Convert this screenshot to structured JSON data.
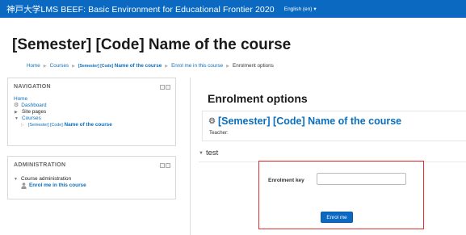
{
  "navbar": {
    "site_title": "神戸大学LMS BEEF: Basic Environment for Educational Frontier 2020",
    "language": "English (en)",
    "language_caret": "▾"
  },
  "page": {
    "title": "[Semester] [Code] Name of the course"
  },
  "breadcrumb": [
    {
      "label": "Home"
    },
    {
      "label": "Courses"
    },
    {
      "label_a": "[Semester] [Code]",
      "label_b": "Name of the course"
    },
    {
      "label": "Enrol me in this course"
    },
    {
      "label": "Enrolment options"
    }
  ],
  "breadcrumb_separator": "▶",
  "navigation_block": {
    "title": "NAVIGATION",
    "home": "Home",
    "dashboard": "Dashboard",
    "site_pages": "Site pages",
    "courses": "Courses",
    "course_a": "[Semester] [Code]",
    "course_b": "Name of the course"
  },
  "admin_block": {
    "title": "ADMINISTRATION",
    "course_administration": "Course administration",
    "enrol_me": "Enrol me in this course"
  },
  "main": {
    "heading": "Enrolment options",
    "course_name": "[Semester] [Code] Name of the course",
    "teacher_label": "Teacher:",
    "section_title": "test",
    "enrolment_key_label": "Enrolment key",
    "enrolment_key_value": "",
    "enrol_button": "Enrol me"
  },
  "colors": {
    "navbar": "#0b69c2",
    "link": "#0a6ebd",
    "highlight": "#e23030"
  }
}
